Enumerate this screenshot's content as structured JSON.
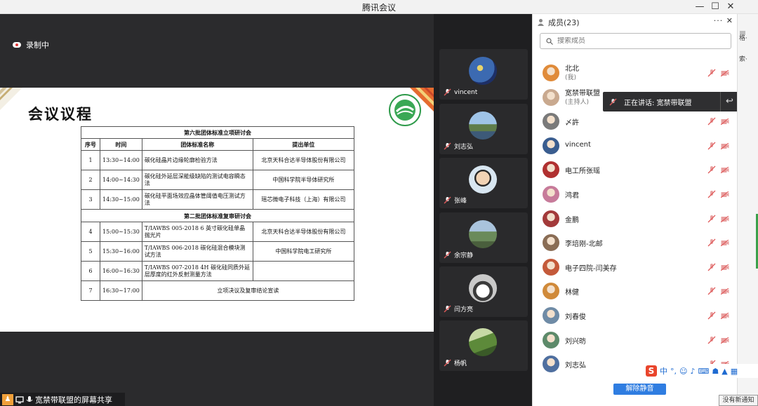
{
  "window": {
    "title": "腾讯会议",
    "minimize": "—",
    "maximize": "☐",
    "close": "✕"
  },
  "stage": {
    "recording_label": "录制中",
    "share_label": "宽禁带联盟的屏幕共享",
    "slide": {
      "heading": "会议议程",
      "table": {
        "title1": "第六批团体标准立项研讨会",
        "headers": [
          "序号",
          "时间",
          "团体标准名称",
          "提出单位"
        ],
        "rows1": [
          {
            "no": "1",
            "time": "13:30~14:00",
            "name": "碳化硅晶片边缘轮廓检验方法",
            "org": "北京天科合达半导体股份有限公司"
          },
          {
            "no": "2",
            "time": "14:00~14:30",
            "name": "碳化硅外延层深能级缺陷的测试电容瞬态法",
            "org": "中国科学院半导体研究所"
          },
          {
            "no": "3",
            "time": "14:30~15:00",
            "name": "碳化硅平面场效应晶体管阈值电压测试方法",
            "org": "瑶芯微电子科技（上海）有限公司"
          }
        ],
        "title2": "第二批团体标准复审研讨会",
        "rows2": [
          {
            "no": "4",
            "time": "15:00~15:30",
            "name": "T/IAWBS 005-2018 6 英寸碳化硅单晶抛光片",
            "org": "北京天科合达半导体股份有限公司"
          },
          {
            "no": "5",
            "time": "15:30~16:00",
            "name": "T/IAWBS 006-2018 碳化硅混合模块测试方法",
            "org": "中国科学院电工研究所"
          },
          {
            "no": "6",
            "time": "16:00~16:30",
            "name": "T/IAWBS 007-2018 4H 碳化硅同质外延层厚度的红外反射测量方法",
            "org": ""
          },
          {
            "no": "7",
            "time": "16:30~17:00",
            "name": "立项决议及复审结论宣读",
            "org": ""
          }
        ]
      }
    }
  },
  "tiles": [
    {
      "name": "vincent"
    },
    {
      "name": "刘志弘"
    },
    {
      "name": "张峰"
    },
    {
      "name": "余宗静"
    },
    {
      "name": "闫方亮"
    },
    {
      "name": "杨帆"
    }
  ],
  "panel": {
    "title": "成员(23)",
    "more": "···",
    "close": "✕",
    "search_placeholder": "搜索成员",
    "members": [
      {
        "name": "北北",
        "sub": "(我)",
        "color": "#e08b3a"
      },
      {
        "name": "宽禁带联盟",
        "sub": "(主持人)",
        "color": "#c9a98f"
      },
      {
        "name": "〆許",
        "sub": "",
        "color": "#7a7a7a"
      },
      {
        "name": "vincent",
        "sub": "",
        "color": "#3a5d8f"
      },
      {
        "name": "电工所张瑶",
        "sub": "",
        "color": "#b03030"
      },
      {
        "name": "鸿君",
        "sub": "",
        "color": "#c77b9a"
      },
      {
        "name": "金鹏",
        "sub": "",
        "color": "#a33a3a"
      },
      {
        "name": "李培刚-北邮",
        "sub": "",
        "color": "#8a6d55"
      },
      {
        "name": "电子四院-闫美存",
        "sub": "",
        "color": "#c45a3a"
      },
      {
        "name": "林健",
        "sub": "",
        "color": "#d08a3a"
      },
      {
        "name": "刘春俊",
        "sub": "",
        "color": "#6f8ba6"
      },
      {
        "name": "刘兴昉",
        "sub": "",
        "color": "#5d8a6a"
      },
      {
        "name": "刘志弘",
        "sub": "",
        "color": "#4f6f9f"
      }
    ],
    "unmute_button": "解除静音",
    "speaking_label": "正在讲话: 宽禁带联盟"
  },
  "right_strip": {
    "text1": "格·",
    "text2": "索·"
  },
  "ime": {
    "logo": "S",
    "mode": "中"
  },
  "toast": "没有新通知",
  "colors": {
    "accent": "#2f7de1",
    "muted_red": "#e05a5a",
    "stage_bg": "#2b2b2d"
  }
}
